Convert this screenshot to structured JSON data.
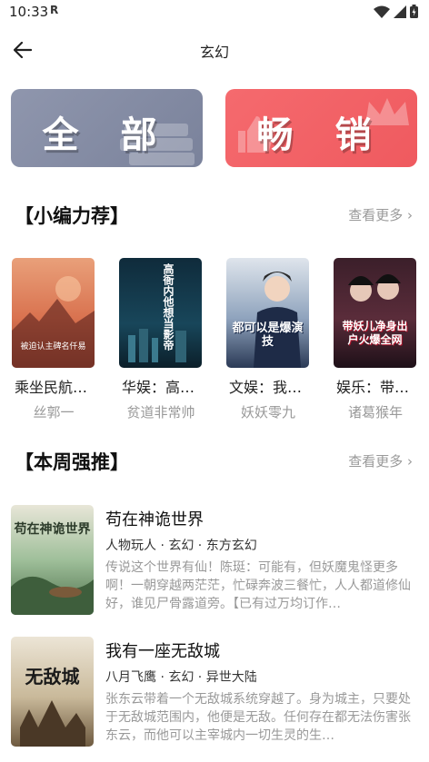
{
  "status_bar": {
    "time": "10:33",
    "r_badge": "R"
  },
  "header": {
    "title": "玄幻"
  },
  "banners": [
    {
      "label": "全 部",
      "color": "#7f879f"
    },
    {
      "label": "畅 销",
      "color": "#f05f64"
    }
  ],
  "editor_picks": {
    "title": "【小编力荐】",
    "more": "查看更多 ›",
    "books": [
      {
        "title": "乘坐民航…",
        "author": "丝郭一",
        "cover_text": "被迫认主碑名仟易"
      },
      {
        "title": "华娱：高…",
        "author": "贫道非常帅",
        "cover_text": "高衙内他想当影帝"
      },
      {
        "title": "文娱：我…",
        "author": "妖妖零九",
        "cover_text": "都可以是爆演技"
      },
      {
        "title": "娱乐：带…",
        "author": "诸葛猴年",
        "cover_text": "带妖儿净身出户火爆全网"
      }
    ]
  },
  "weekly_push": {
    "title": "【本周强推】",
    "more": "查看更多 ›",
    "books": [
      {
        "title": "苟在神诡世界",
        "meta": "人物玩人 · 玄幻 · 东方玄幻",
        "desc": "传说这个世界有仙！陈珽：可能有，但妖魔鬼怪更多啊！一朝穿越两茫茫，忙碌奔波三餐忙，人人都道修仙好，谁见尸骨露道旁。【已有过万均订作…",
        "cover_text": "苟在神诡世界"
      },
      {
        "title": "我有一座无敌城",
        "meta": "八月飞鹰 · 玄幻 · 异世大陆",
        "desc": "张东云带着一个无敌城系统穿越了。身为城主，只要处于无敌城范围内，他便是无敌。任何存在都无法伤害张东云，而他可以主宰城内一切生灵的生…",
        "cover_text": "无敌城"
      }
    ]
  },
  "colors": {
    "accent_gray": "#7f879f",
    "accent_red": "#f05f64",
    "muted_text": "#999999"
  }
}
